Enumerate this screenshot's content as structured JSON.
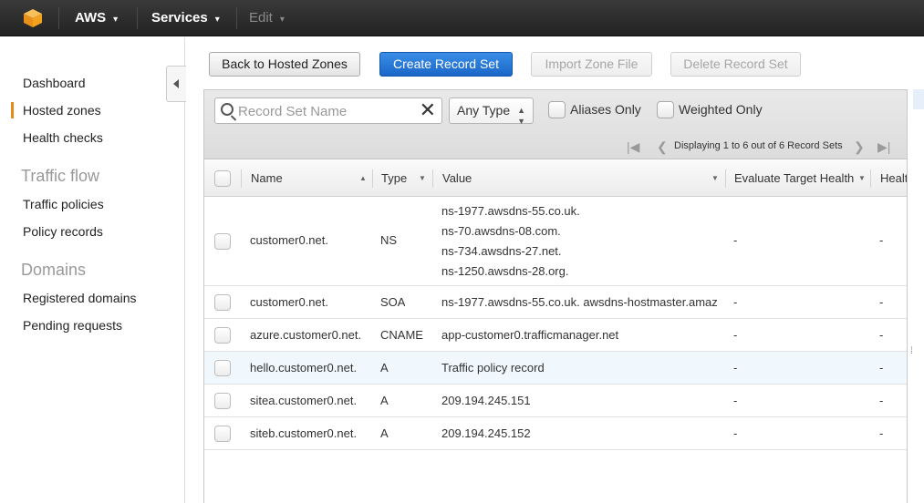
{
  "topbar": {
    "brand": "AWS",
    "services": "Services",
    "edit": "Edit",
    "chevron": "▾",
    "logo_icon": "aws-cube-icon",
    "logo_color": "#f4a11d"
  },
  "sidebar": {
    "items": [
      {
        "label": "Dashboard"
      },
      {
        "label": "Hosted zones",
        "active": true
      },
      {
        "label": "Health checks"
      }
    ],
    "traffic_flow": {
      "heading": "Traffic flow",
      "items": [
        {
          "label": "Traffic policies"
        },
        {
          "label": "Policy records"
        }
      ]
    },
    "domains": {
      "heading": "Domains",
      "items": [
        {
          "label": "Registered domains"
        },
        {
          "label": "Pending requests"
        }
      ]
    }
  },
  "toolbar": {
    "back_label": "Back to Hosted Zones",
    "create_label": "Create Record Set",
    "import_label": "Import Zone File",
    "delete_label": "Delete Record Set"
  },
  "filter": {
    "search_placeholder": "Record Set Name",
    "search_value": "",
    "clear_icon": "✕",
    "type_value": "Any Type",
    "aliases_label": "Aliases Only",
    "weighted_label": "Weighted Only"
  },
  "pager": {
    "text": "Displaying 1 to 6 out of 6 Record Sets"
  },
  "table": {
    "columns": {
      "name": "Name",
      "type": "Type",
      "value": "Value",
      "evaluate": "Evaluate Target Health",
      "health": "Healt"
    },
    "rows": [
      {
        "name": "customer0.net.",
        "type": "NS",
        "value": [
          "ns-1977.awsdns-55.co.uk.",
          "ns-70.awsdns-08.com.",
          "ns-734.awsdns-27.net.",
          "ns-1250.awsdns-28.org."
        ],
        "evaluate": "-",
        "health": "-"
      },
      {
        "name": "customer0.net.",
        "type": "SOA",
        "value": [
          "ns-1977.awsdns-55.co.uk. awsdns-hostmaster.amaz"
        ],
        "evaluate": "-",
        "health": "-"
      },
      {
        "name": "azure.customer0.net.",
        "type": "CNAME",
        "value": [
          "app-customer0.trafficmanager.net"
        ],
        "evaluate": "-",
        "health": "-"
      },
      {
        "name": "hello.customer0.net.",
        "type": "A",
        "value": [
          "Traffic policy record"
        ],
        "evaluate": "-",
        "health": "-",
        "highlighted": true
      },
      {
        "name": "sitea.customer0.net.",
        "type": "A",
        "value": [
          "209.194.245.151"
        ],
        "evaluate": "-",
        "health": "-"
      },
      {
        "name": "siteb.customer0.net.",
        "type": "A",
        "value": [
          "209.194.245.152"
        ],
        "evaluate": "-",
        "health": "-"
      }
    ]
  },
  "colors": {
    "primary_button": "#1a66c8",
    "active_marker": "#e88a1a",
    "highlight_row": "#f1f8fd"
  }
}
